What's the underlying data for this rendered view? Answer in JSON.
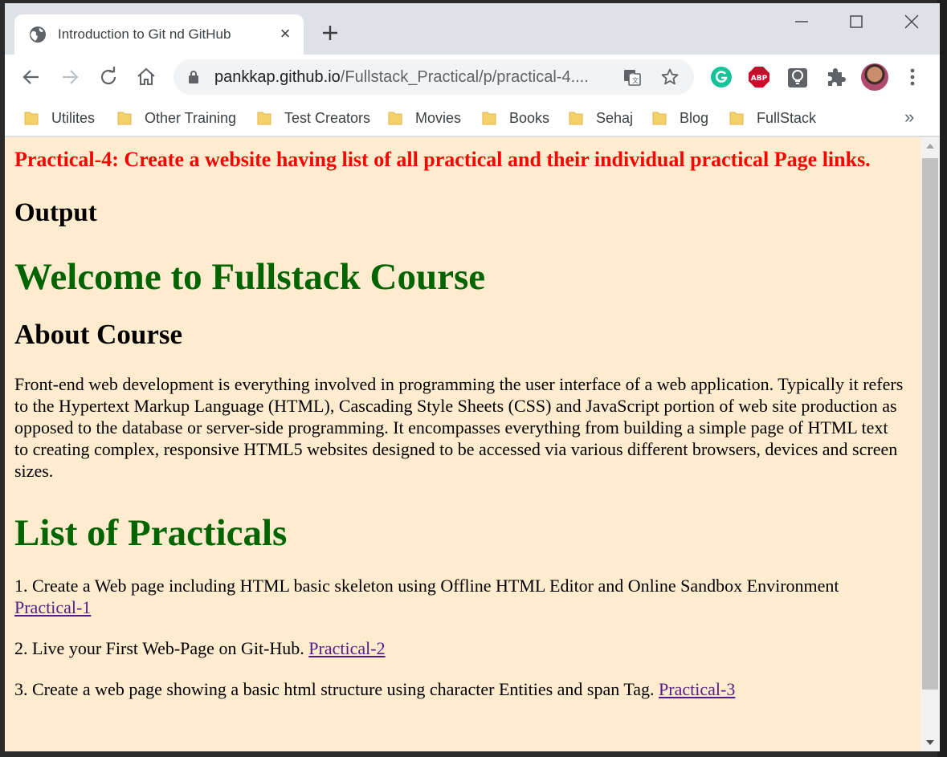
{
  "browser": {
    "tab_title": "Introduction to Git nd GitHub",
    "url_host": "pankkap.github.io",
    "url_path": "/Fullstack_Practical/p/practical-4....",
    "bookmarks": [
      "Utilites",
      "Other Training",
      "Test Creators",
      "Movies",
      "Books",
      "Sehaj",
      "Blog",
      "FullStack"
    ],
    "bookmarks_overflow": "»",
    "extensions": [
      "grammarly-icon",
      "adblock-plus-icon",
      "extension-bulb-icon",
      "extensions-puzzle-icon"
    ],
    "ext_abp_label": "ABP"
  },
  "page": {
    "practical_title": "Practical-4: Create a website having list of all practical and their individual practical Page links.",
    "output_heading": "Output",
    "welcome_heading": "Welcome to Fullstack Course",
    "about_heading": "About Course",
    "about_text": "Front-end web development is everything involved in programming the user interface of a web application. Typically it refers to the Hypertext Markup Language (HTML), Cascading Style Sheets (CSS) and JavaScript portion of web site production as opposed to the database or server-side programming. It encompasses everything from building a simple page of HTML text to creating complex, responsive HTML5 websites designed to be accessed via various different browsers, devices and screen sizes.",
    "list_heading": "List of Practicals",
    "practicals": [
      {
        "text": "1. Create a Web page including HTML basic skeleton using Offline HTML Editor and Online Sandbox Environment ",
        "link": "Practical-1"
      },
      {
        "text": "2. Live your First Web-Page on Git-Hub. ",
        "link": "Practical-2"
      },
      {
        "text": "3. Create a web page showing a basic html structure using character Entities and span Tag. ",
        "link": "Practical-3"
      }
    ]
  },
  "colors": {
    "page_bg": "#ffebcd",
    "title_red": "#ff0000",
    "heading_green": "#006400",
    "visited_link": "#551a8b"
  }
}
